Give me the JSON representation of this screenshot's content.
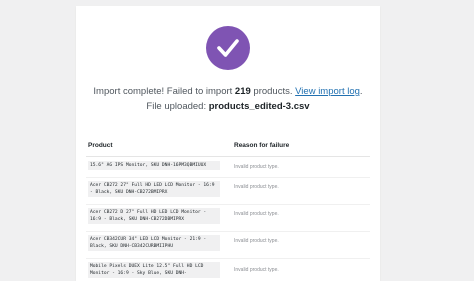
{
  "import": {
    "prefix": "Import complete! Failed to import ",
    "count": "219",
    "middle": " products. ",
    "link": "View import log",
    "suffix": ". File uploaded: ",
    "filename": "products_edited-3.csv"
  },
  "table": {
    "headers": [
      "Product",
      "Reason for failure"
    ],
    "rows": [
      {
        "product": "15.6\" AG IPS Monitor, SKU DNH-16PM3QBMIUUX",
        "reason": "Invalid product type."
      },
      {
        "product": "Acer CB272 27\" Full HD LED LCD Monitor - 16:9 - Black, SKU DNH-CB272BMIPRX",
        "reason": "Invalid product type."
      },
      {
        "product": "Acer CB272 D 27\" Full HD LED LCD Monitor - 16:9 - Black, SKU DNH-CB272DBMIPRX",
        "reason": "Invalid product type."
      },
      {
        "product": "Acer CB342CUR 34\" LED LCD Monitor - 21:9 - Black, SKU DNH-CB342CURBMIIPHU",
        "reason": "Invalid product type."
      },
      {
        "product": "Mobile Pixels DUEX Lite 12.5\" Full HD LCD Monitor - 16:9 - Sky Blue, SKU DNH-",
        "reason": "Invalid product type."
      }
    ]
  },
  "colors": {
    "badge": "#7f54b3",
    "link": "#2271b1"
  },
  "icons": {
    "badge": "checkmark-icon"
  }
}
